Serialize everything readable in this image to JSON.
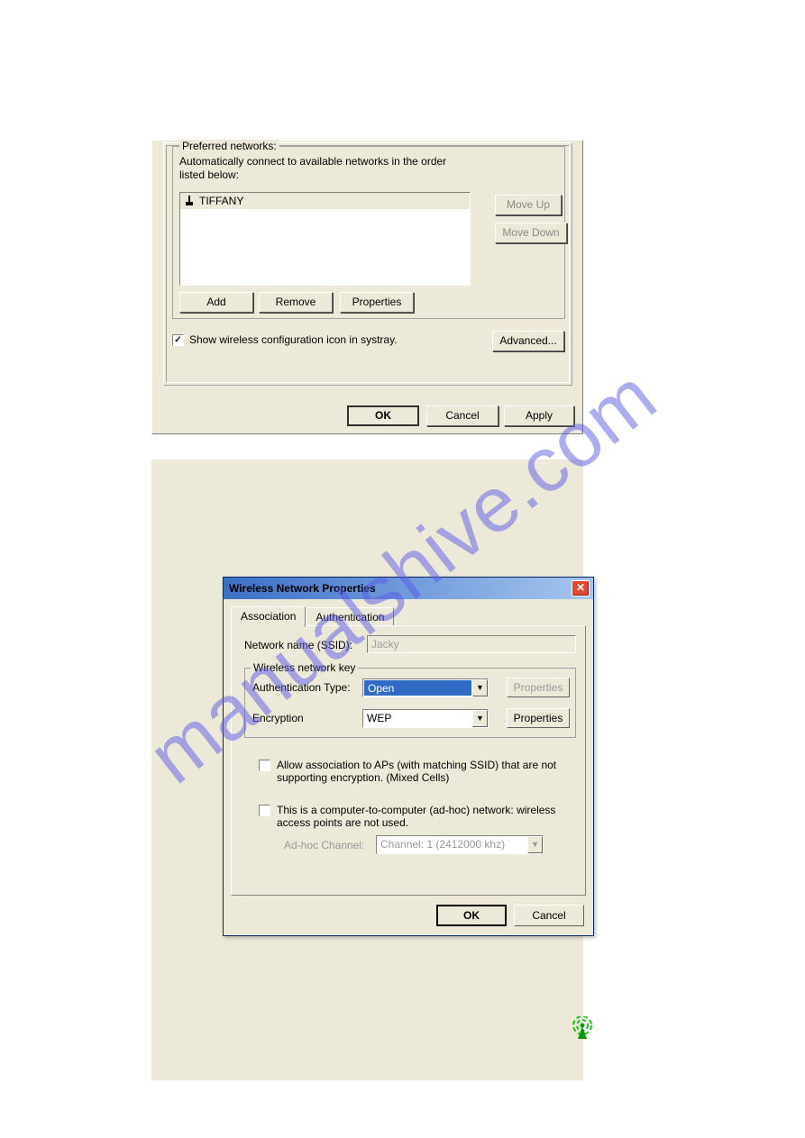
{
  "watermark": "manualshive.com",
  "panel1": {
    "group_label": "Preferred networks:",
    "description": "Automatically connect to available networks in the order listed below:",
    "network_list": [
      "TIFFANY"
    ],
    "buttons": {
      "move_up": "Move Up",
      "move_down": "Move Down",
      "add": "Add",
      "remove": "Remove",
      "properties": "Properties",
      "advanced": "Advanced..."
    },
    "systray_checkbox_label": "Show wireless configuration icon in systray.",
    "systray_checkbox_checked": true,
    "footer": {
      "ok": "OK",
      "cancel": "Cancel",
      "apply": "Apply"
    }
  },
  "dialog": {
    "title": "Wireless Network Properties",
    "tabs": {
      "association": "Association",
      "authentication": "Authentication"
    },
    "ssid_label": "Network name (SSID):",
    "ssid_value": "Jacky",
    "group_key_label": "Wireless network key",
    "auth_label": "Authentication Type:",
    "auth_value": "Open",
    "enc_label": "Encryption",
    "enc_value": "WEP",
    "auth_properties": "Properties",
    "enc_properties": "Properties",
    "allow_mixed_label": "Allow association to APs (with matching SSID) that are not supporting encryption. (Mixed Cells)",
    "adhoc_label": "This is a computer-to-computer (ad-hoc) network: wireless access points are not used.",
    "adhoc_channel_label": "Ad-hoc Channel:",
    "adhoc_channel_value": "Channel:  1 (2412000 khz)",
    "footer": {
      "ok": "OK",
      "cancel": "Cancel"
    }
  }
}
